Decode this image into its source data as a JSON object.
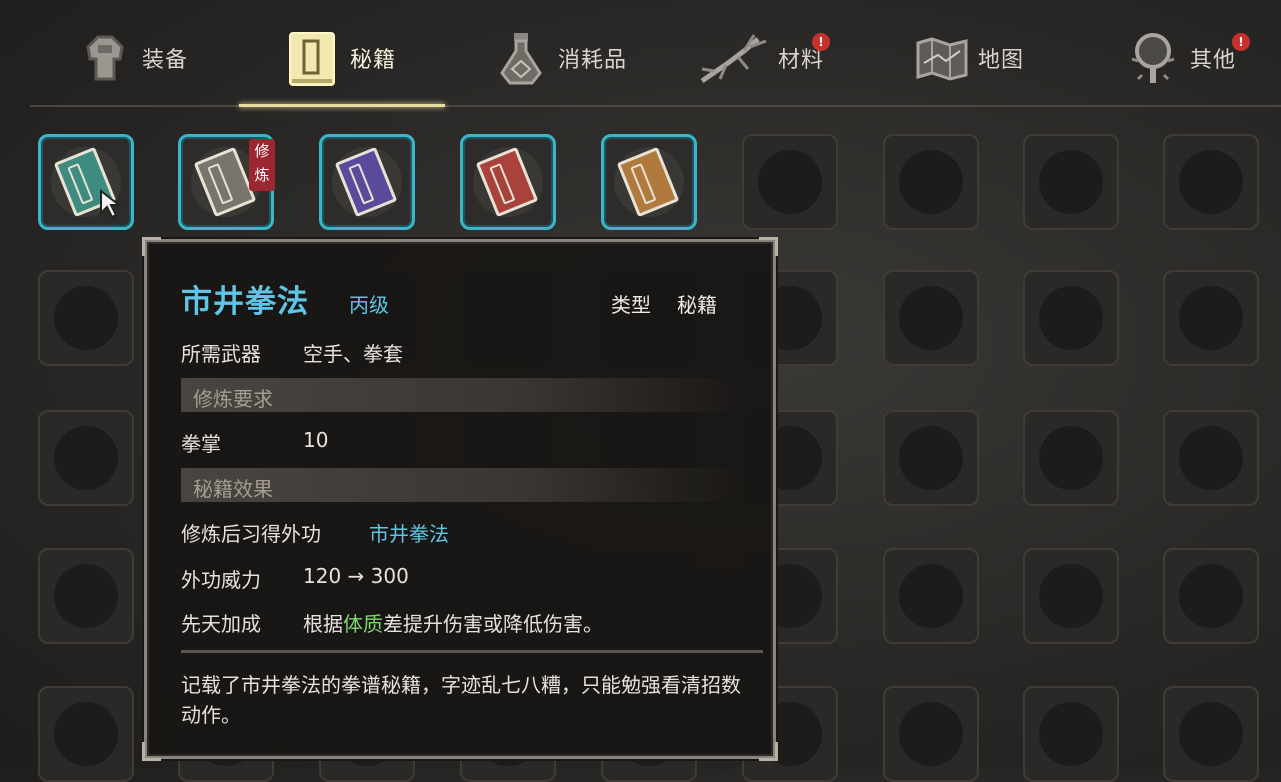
{
  "tabs": [
    {
      "label": "装备",
      "icon": "armor-icon"
    },
    {
      "label": "秘籍",
      "icon": "manual-book-icon",
      "active": true
    },
    {
      "label": "消耗品",
      "icon": "potion-flask-icon"
    },
    {
      "label": "材料",
      "icon": "herb-root-icon",
      "badge": "!"
    },
    {
      "label": "地图",
      "icon": "map-icon"
    },
    {
      "label": "其他",
      "icon": "magnifier-icon",
      "badge": "!"
    }
  ],
  "inventory": {
    "items": [
      {
        "icon": "teal-manual-icon",
        "color": "#3e8c80"
      },
      {
        "icon": "gray-manual-icon",
        "color": "#77756e",
        "tag": "修炼"
      },
      {
        "icon": "purple-manual-icon",
        "color": "#5a4a9c"
      },
      {
        "icon": "red-scroll-icon",
        "color": "#a8423a"
      },
      {
        "icon": "tan-scroll-icon",
        "color": "#b07a3e"
      }
    ]
  },
  "tooltip": {
    "name": "市井拳法",
    "grade": "丙级",
    "type_label": "类型",
    "type_value": "秘籍",
    "weapon_label": "所需武器",
    "weapon_value": "空手、拳套",
    "req_header": "修炼要求",
    "req_skill": "拳掌",
    "req_value": "10",
    "effect_header": "秘籍效果",
    "learn_label": "修炼后习得外功",
    "learn_value": "市井拳法",
    "power_label": "外功威力",
    "power_value": "120 → 300",
    "innate_label": "先天加成",
    "innate_pre": "根据",
    "innate_attr": "体质",
    "innate_post": "差提升伤害或降低伤害。",
    "description": "记载了市井拳法的拳谱秘籍，字迹乱七八糟，只能勉强看清招数动作。"
  }
}
